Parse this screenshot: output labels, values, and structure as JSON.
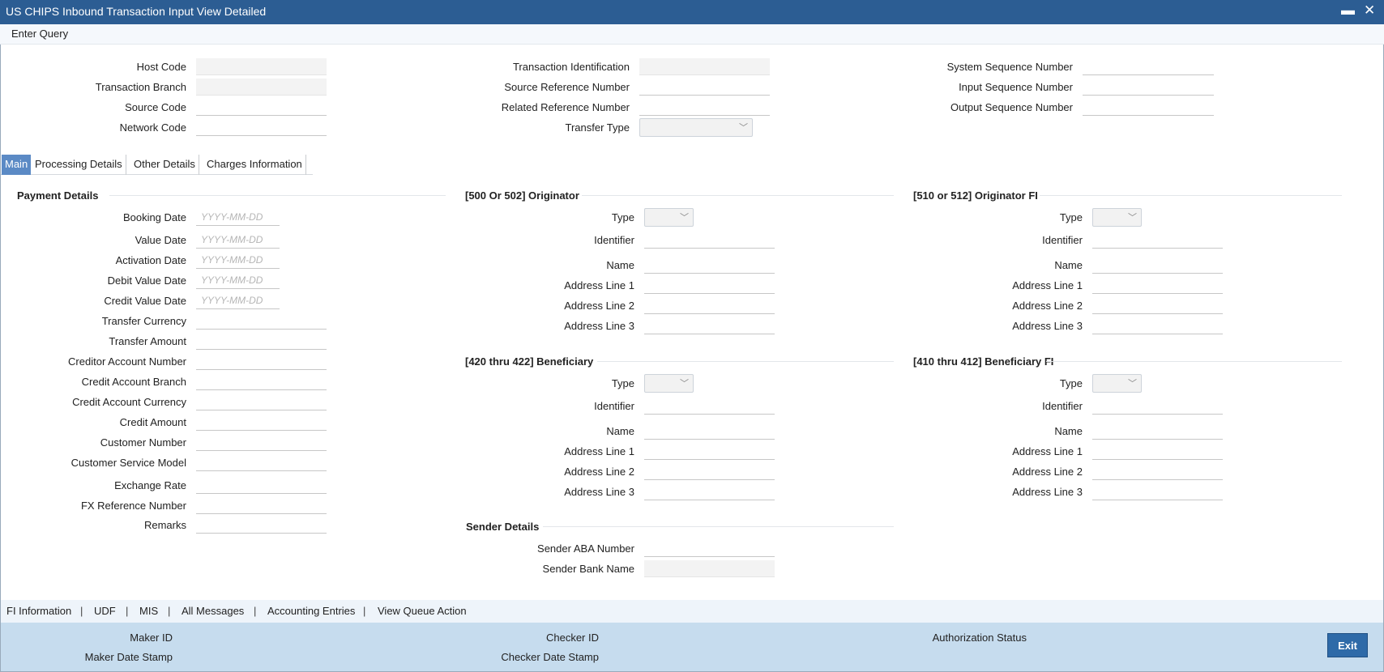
{
  "window": {
    "title": "US CHIPS Inbound Transaction Input View Detailed",
    "minimize_icon": "minimize-icon",
    "close_icon": "close-icon",
    "minimize_glyph": "▬",
    "close_glyph": "✕"
  },
  "menu": {
    "enter_query": "Enter Query"
  },
  "header": {
    "host_code": "Host Code",
    "transaction_branch": "Transaction Branch",
    "source_code": "Source Code",
    "network_code": "Network Code",
    "transaction_identification": "Transaction Identification",
    "source_reference_number": "Source Reference Number",
    "related_reference_number": "Related Reference Number",
    "transfer_type": "Transfer Type",
    "system_sequence_number": "System Sequence Number",
    "input_sequence_number": "Input Sequence Number",
    "output_sequence_number": "Output Sequence Number"
  },
  "tabs": [
    "Main",
    "Processing Details",
    "Other Details",
    "Charges Information"
  ],
  "date_placeholder": "YYYY-MM-DD",
  "payment_details": {
    "title": "Payment Details",
    "booking_date": "Booking Date",
    "value_date": "Value Date",
    "activation_date": "Activation Date",
    "debit_value_date": "Debit Value Date",
    "credit_value_date": "Credit Value Date",
    "transfer_currency": "Transfer Currency",
    "transfer_amount": "Transfer Amount",
    "creditor_account_number": "Creditor Account Number",
    "credit_account_branch": "Credit Account Branch",
    "credit_account_currency": "Credit Account Currency",
    "credit_amount": "Credit Amount",
    "customer_number": "Customer Number",
    "customer_service_model": "Customer Service Model",
    "exchange_rate": "Exchange Rate",
    "fx_reference_number": "FX Reference Number",
    "remarks": "Remarks"
  },
  "party_labels": {
    "type": "Type",
    "identifier": "Identifier",
    "name": "Name",
    "address1": "Address Line 1",
    "address2": "Address Line 2",
    "address3": "Address Line 3"
  },
  "originator": {
    "title": "[500 Or 502] Originator"
  },
  "originator_fi": {
    "title": "[510 or 512] Originator FI"
  },
  "beneficiary": {
    "title": "[420 thru 422] Beneficiary"
  },
  "beneficiary_fi": {
    "title": "[410 thru 412] Beneficiary FI"
  },
  "sender": {
    "title": "Sender Details",
    "aba_number": "Sender ABA Number",
    "bank_name": "Sender Bank Name"
  },
  "bottom_links": [
    "FI Information",
    "UDF",
    "MIS",
    "All Messages",
    "Accounting Entries",
    "View Queue Action"
  ],
  "footer": {
    "maker_id": "Maker ID",
    "maker_date_stamp": "Maker Date Stamp",
    "checker_id": "Checker ID",
    "checker_date_stamp": "Checker Date Stamp",
    "authorization_status": "Authorization Status",
    "exit": "Exit"
  }
}
